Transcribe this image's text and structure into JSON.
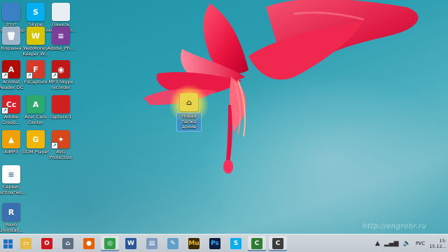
{
  "desktop": {
    "icons": [
      {
        "label": "Этот\nкомпьютер",
        "icon": "computer-icon",
        "color": "#3b7fc4",
        "glyph": ""
      },
      {
        "label": "Skype",
        "icon": "skype-icon",
        "color": "#00aff0",
        "glyph": "S"
      },
      {
        "label": "Панель\nзапуска пр...",
        "icon": "control-panel-icon",
        "color": "#e8eef3",
        "glyph": ""
      },
      {
        "label": "Корзина",
        "icon": "recycle-bin-icon",
        "color": "#9fb4c8",
        "glyph": "🗑"
      },
      {
        "label": "WebMoney\nKeeper W...",
        "icon": "webmoney-icon",
        "color": "#d9c400",
        "glyph": "W"
      },
      {
        "label": "Adobe_Ph...",
        "icon": "winrar-archive-icon",
        "color": "#7b3f99",
        "glyph": "≡"
      },
      {
        "label": "Acrobat\nReader DC",
        "icon": "acrobat-reader-icon",
        "color": "#b30b00",
        "glyph": "A"
      },
      {
        "label": "FsCapture",
        "icon": "fscapture-icon",
        "color": "#d63a2a",
        "glyph": "F"
      },
      {
        "label": "MP3 Skype\nrecorder",
        "icon": "mp3-skype-recorder-icon",
        "color": "#c01818",
        "glyph": "◉"
      },
      {
        "label": "Adobe\nCreati...",
        "icon": "adobe-creative-cloud-icon",
        "color": "#da1f26",
        "glyph": "Cc"
      },
      {
        "label": "Acer Care\nCenter",
        "icon": "acer-care-center-icon",
        "color": "#2eaa6e",
        "glyph": "A"
      },
      {
        "label": "capture-1",
        "icon": "capture-file-icon",
        "color": "#d11f1f",
        "glyph": ""
      },
      {
        "label": "AIMP3",
        "icon": "aimp-icon",
        "color": "#f0a000",
        "glyph": "▲"
      },
      {
        "label": "GOM Player",
        "icon": "gom-player-icon",
        "color": "#f2b600",
        "glyph": "G"
      },
      {
        "label": "AVG\nProtection",
        "icon": "avg-icon",
        "color": "#d8471c",
        "glyph": "✦"
      },
      {
        "label": "Сервис\nбесплатно...",
        "icon": "document-icon",
        "color": "#ffffff",
        "glyph": "≡"
      },
      {
        "label": "Revo\nUninstall...",
        "icon": "revo-uninstaller-icon",
        "color": "#3a6fb0",
        "glyph": "R"
      }
    ],
    "dragged_item": {
      "label": "Новая папка\nархив",
      "icon": "archive-folder-icon"
    }
  },
  "watermark": "http://engrobr.ru",
  "taskbar": {
    "apps": [
      {
        "name": "file-explorer",
        "icon": "file-explorer-icon",
        "color": "#e6b940",
        "glyph": "▭",
        "active": false
      },
      {
        "name": "opera",
        "icon": "opera-icon",
        "color": "#d0141e",
        "glyph": "O",
        "active": false
      },
      {
        "name": "home",
        "icon": "home-icon",
        "color": "#5d6f80",
        "glyph": "⌂",
        "active": false
      },
      {
        "name": "firefox",
        "icon": "firefox-icon",
        "color": "#e66000",
        "glyph": "●",
        "active": false
      },
      {
        "name": "chrome",
        "icon": "chrome-icon",
        "color": "#2f9f46",
        "glyph": "◎",
        "active": true
      },
      {
        "name": "word",
        "icon": "word-icon",
        "color": "#2b579a",
        "glyph": "W",
        "active": false
      },
      {
        "name": "document-viewer",
        "icon": "document-viewer-icon",
        "color": "#7c9bbd",
        "glyph": "▤",
        "active": false
      },
      {
        "name": "notepad",
        "icon": "notepad-icon",
        "color": "#5ea0c8",
        "glyph": "✎",
        "active": false
      },
      {
        "name": "muse",
        "icon": "adobe-muse-icon",
        "color": "#3c2a00",
        "glyph": "Mu",
        "active": false
      },
      {
        "name": "photoshop",
        "icon": "photoshop-icon",
        "color": "#0a1e3c",
        "glyph": "Ps",
        "active": false
      },
      {
        "name": "skype",
        "icon": "skype-icon",
        "color": "#00aff0",
        "glyph": "S",
        "active": false
      },
      {
        "name": "camtasia",
        "icon": "camtasia-icon",
        "color": "#2f7d32",
        "glyph": "C",
        "active": true
      },
      {
        "name": "camtasia-recorder",
        "icon": "camtasia-recorder-icon",
        "color": "#3d3d3d",
        "glyph": "C",
        "active": true
      }
    ],
    "tray": {
      "language": "РУС",
      "time": "15:",
      "date": "15.12..."
    }
  }
}
